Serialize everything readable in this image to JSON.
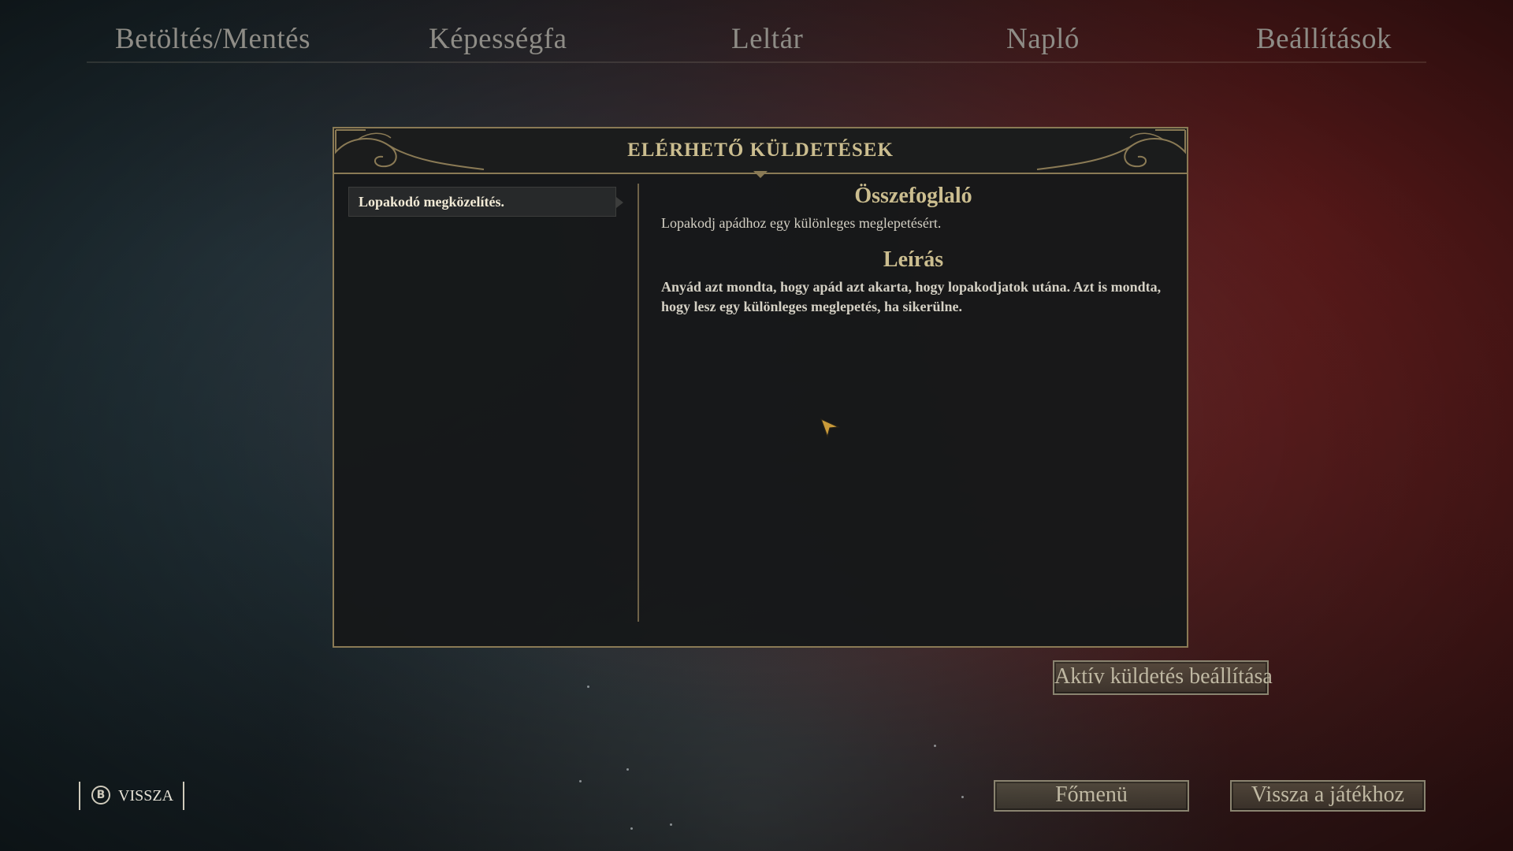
{
  "nav": {
    "tabs": [
      {
        "label": "Betöltés/Mentés"
      },
      {
        "label": "Képességfa"
      },
      {
        "label": "Leltár"
      },
      {
        "label": "Napló"
      },
      {
        "label": "Beállítások"
      }
    ]
  },
  "panel": {
    "title": "ELÉRHETŐ KÜLDETÉSEK",
    "quests": [
      {
        "label": "Lopakodó megközelítés."
      }
    ],
    "summary_heading": "Összefoglaló",
    "summary_text": "Lopakodj apádhoz egy különleges meglepetésért.",
    "description_heading": "Leírás",
    "description_text": "Anyád azt mondta, hogy apád azt akarta, hogy lopakodjatok utána. Azt is mondta, hogy lesz egy különleges meglepetés, ha sikerülne."
  },
  "buttons": {
    "set_active_quest": "Aktív küldetés beállítása",
    "main_menu": "Főmenü",
    "return_to_game": "Vissza a játékhoz"
  },
  "back": {
    "button_glyph": "B",
    "label": "VISSZA"
  },
  "colors": {
    "accent_gold": "#cbbd8f",
    "panel_border": "#8a7a55"
  }
}
